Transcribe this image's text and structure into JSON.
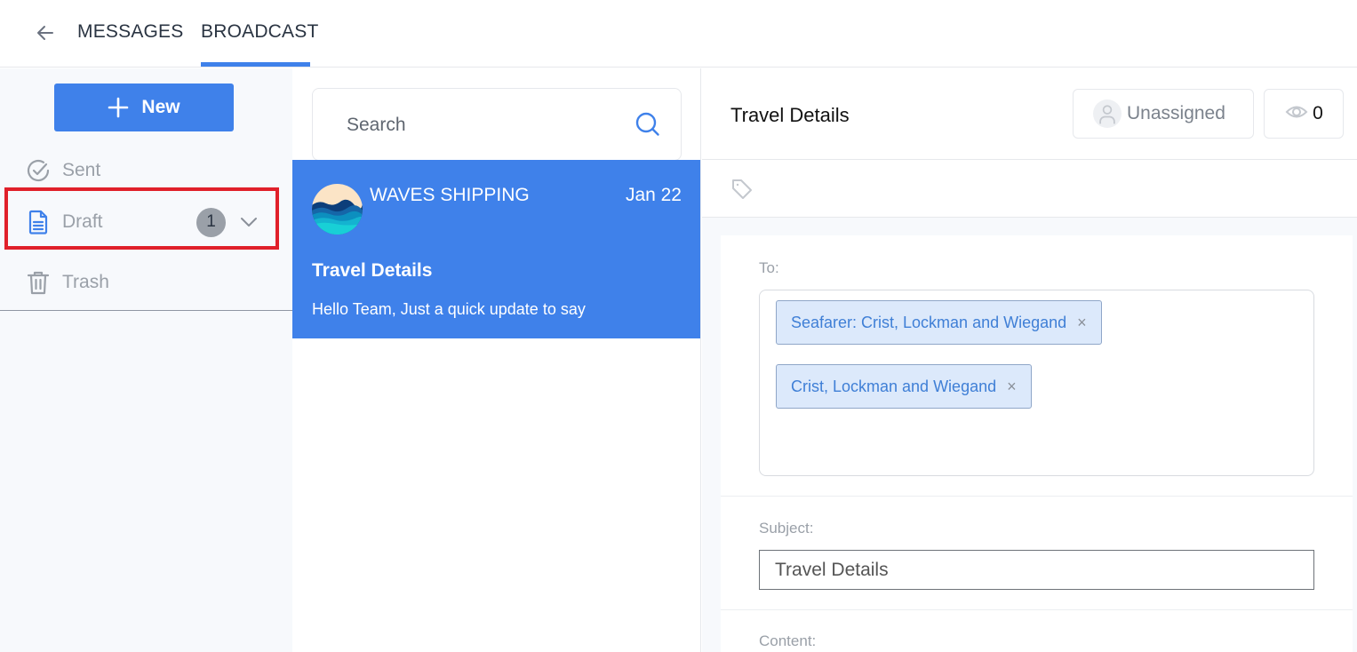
{
  "topnav": {
    "back_icon": "arrow-left-icon",
    "tabs": [
      {
        "label": "MESSAGES",
        "active": false
      },
      {
        "label": "BROADCAST",
        "active": true
      }
    ],
    "accent_color": "#3f81ea"
  },
  "sidebar": {
    "new_button": {
      "label": "New",
      "icon": "plus-icon"
    },
    "items": [
      {
        "label": "Sent",
        "icon": "check-circle-icon"
      },
      {
        "label": "Draft",
        "icon": "document-icon",
        "badge": "1",
        "expand_icon": "chevron-down-icon",
        "highlighted": true
      },
      {
        "label": "Trash",
        "icon": "trash-icon"
      }
    ]
  },
  "list": {
    "search": {
      "placeholder": "Search",
      "value": "",
      "icon": "search-icon"
    },
    "messages": [
      {
        "sender": "WAVES SHIPPING",
        "date": "Jan 22",
        "subject": "Travel Details",
        "preview": "Hello Team, Just a quick update to say",
        "selected": true
      }
    ]
  },
  "detail": {
    "title": "Travel Details",
    "assignee": {
      "label": "Unassigned",
      "icon": "user-icon"
    },
    "views": {
      "count": "0",
      "icon": "eye-icon"
    },
    "tag_icon": "tag-icon",
    "form": {
      "to_label": "To:",
      "recipients": [
        {
          "label": "Seafarer: Crist, Lockman and Wiegand",
          "remove": "×"
        },
        {
          "label": "Crist, Lockman and Wiegand",
          "remove": "×"
        }
      ],
      "subject_label": "Subject:",
      "subject_value": "Travel Details",
      "content_label": "Content:"
    }
  }
}
